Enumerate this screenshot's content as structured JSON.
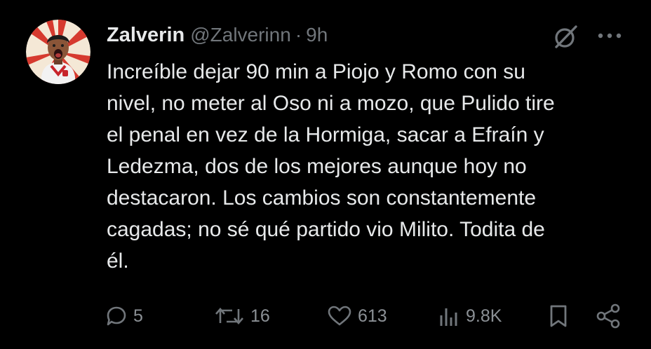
{
  "tweet": {
    "author_name": "Zalverin",
    "handle": "@Zalverinn",
    "separator": "·",
    "time": "9h",
    "text": "Increíble dejar 90 min a Piojo y Romo con su\nnivel, no meter al Oso ni a mozo, que Pulido tire\nel penal en vez de la Hormiga, sacar a Efraín y\nLedezma, dos de los mejores aunque hoy no\ndestacaron. Los cambios son constantemente\ncagadas; no sé qué partido vio Milito. Todita de\nél."
  },
  "actions": {
    "replies": "5",
    "reposts": "16",
    "likes": "613",
    "views": "9.8K"
  },
  "icons": {
    "reply": "reply-icon",
    "repost": "repost-icon",
    "like": "heart-icon",
    "views": "views-icon",
    "bookmark": "bookmark-icon",
    "share": "share-icon",
    "grok": "grok-icon",
    "more": "more-icon"
  },
  "colors": {
    "background": "#000000",
    "text": "#e7e9ea",
    "secondary": "#71767b"
  }
}
